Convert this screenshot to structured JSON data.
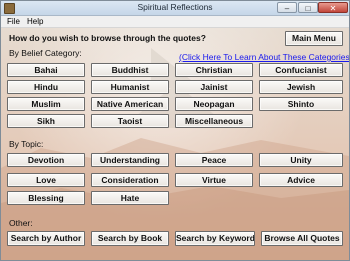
{
  "window": {
    "title": "Spiritual Reflections",
    "minimize": "–",
    "maximize": "□",
    "close": "✕"
  },
  "menu": {
    "file": "File",
    "help": "Help"
  },
  "question": "How do you wish to browse through the quotes?",
  "main_menu": "Main Menu",
  "belief_heading": "By Belief Category:",
  "learn_link": "(Click Here To Learn About These Categories)",
  "beliefs": [
    "Bahai",
    "Buddhist",
    "Christian",
    "Confucianist",
    "Hindu",
    "Humanist",
    "Jainist",
    "Jewish",
    "Muslim",
    "Native American",
    "Neopagan",
    "Shinto",
    "Sikh",
    "Taoist",
    "Miscellaneous"
  ],
  "topic_heading": "By Topic:",
  "topics": [
    "Devotion",
    "Understanding",
    "Peace",
    "Unity",
    "Love",
    "Consideration",
    "Virtue",
    "Advice",
    "Blessing",
    "Hate"
  ],
  "other_heading": "Other:",
  "other": [
    "Search by Author",
    "Search by Book",
    "Search by Keyword",
    "Browse All Quotes"
  ]
}
